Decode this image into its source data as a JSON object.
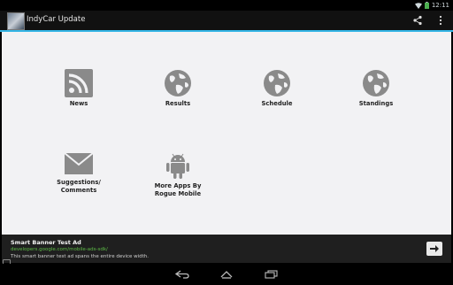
{
  "status_bar": {
    "time": "12:11"
  },
  "action_bar": {
    "title": "IndyCar Update",
    "share_icon": "share-icon",
    "overflow_icon": "overflow-menu-icon"
  },
  "tiles": [
    {
      "label": "News",
      "icon": "rss-icon"
    },
    {
      "label": "Results",
      "icon": "globe-icon"
    },
    {
      "label": "Schedule",
      "icon": "globe-icon"
    },
    {
      "label": "Standings",
      "icon": "globe-icon"
    },
    {
      "label": "Suggestions/\nComments",
      "icon": "envelope-icon"
    },
    {
      "label": "More Apps By\nRogue Mobile",
      "icon": "android-icon"
    }
  ],
  "ad": {
    "title": "Smart Banner Test Ad",
    "url": "developers.google.com/mobile-ads-sdk/",
    "description": "This smart banner test ad spans the entire device width."
  },
  "colors": {
    "accent": "#33b5e5",
    "icon_gray": "#8a8a8a",
    "content_bg": "#f2f2f4",
    "ad_link": "#5dbb46"
  }
}
